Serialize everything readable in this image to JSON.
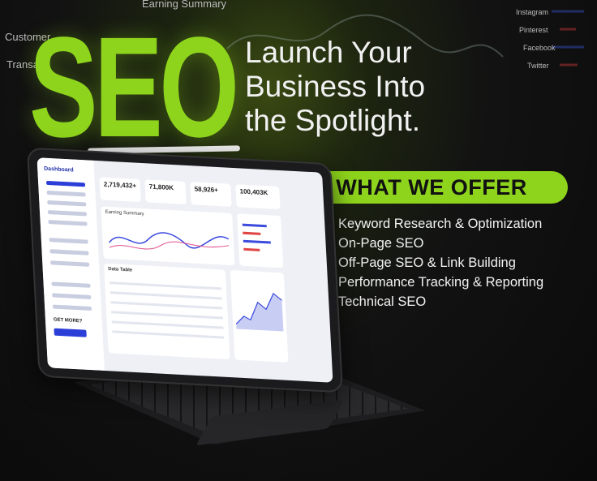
{
  "headline": "SEO",
  "tagline": [
    "Launch Your",
    "Business Into",
    "the Spotlight."
  ],
  "offer_title": "WHAT WE OFFER",
  "offers": [
    "Keyword Research & Optimization",
    "On-Page SEO",
    "Off-Page SEO & Link Building",
    "Performance Tracking & Reporting",
    "Technical SEO"
  ],
  "background_dashboard": {
    "labels": [
      "Earning Summary",
      "Customer",
      "Transa",
      "Instagram",
      "Pinterest",
      "Facebook",
      "Twitter"
    ]
  },
  "tablet_screen": {
    "logo": "Dashboard",
    "kpis": [
      "2,719,432+",
      "71,800K",
      "58,926+",
      "100,403K"
    ],
    "panels": [
      "Earning Summary",
      "Data Table"
    ],
    "cta": "GET MORE?"
  },
  "colors": {
    "accent": "#8ed41c",
    "background": "#111111"
  }
}
